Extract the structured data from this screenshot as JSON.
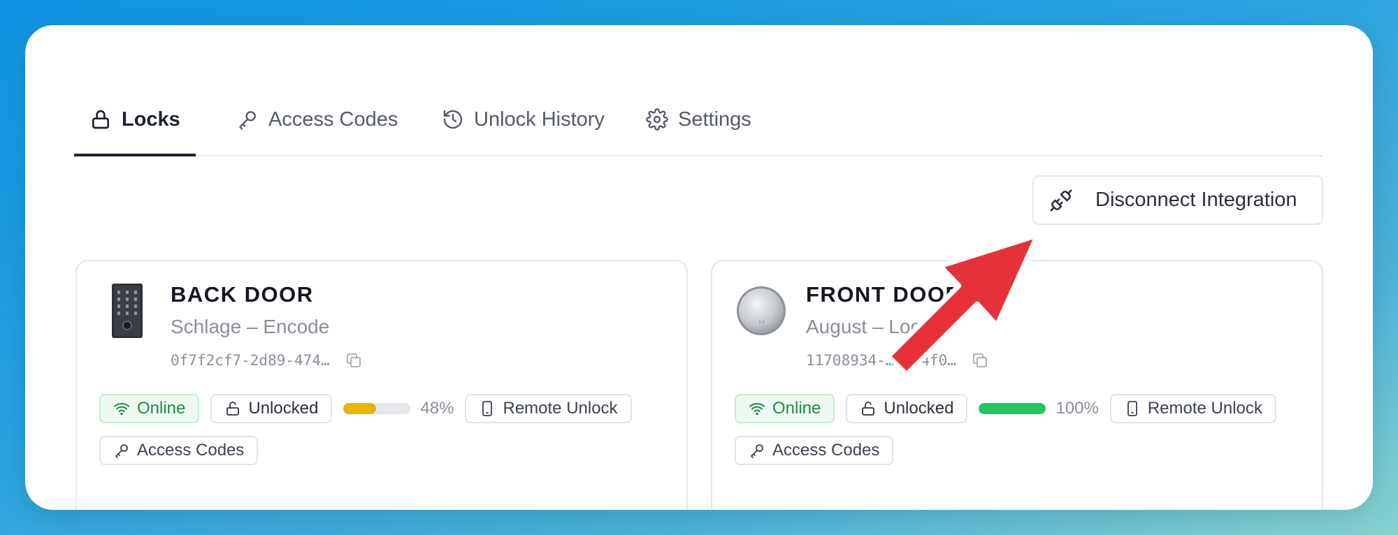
{
  "tabs": [
    {
      "label": "Locks",
      "icon": "lock-icon",
      "active": true
    },
    {
      "label": "Access Codes",
      "icon": "key-icon"
    },
    {
      "label": "Unlock History",
      "icon": "history-icon"
    },
    {
      "label": "Settings",
      "icon": "gear-icon"
    }
  ],
  "disconnect": {
    "label": "Disconnect Integration",
    "icon": "plug-disconnect-icon"
  },
  "locks": [
    {
      "name": "BACK DOOR",
      "model": "Schlage – Encode",
      "id": "0f7f2cf7-2d89-474…",
      "status": "Online",
      "lock_state": "Unlocked",
      "battery_pct": 48,
      "battery_label": "48%",
      "battery_color": "#eab308",
      "remote_label": "Remote Unlock",
      "codes_label": "Access Codes"
    },
    {
      "name": "FRONT DOOR",
      "model": "August – Lock",
      "id": "11708934-…c0-4f0…",
      "status": "Online",
      "lock_state": "Unlocked",
      "battery_pct": 100,
      "battery_label": "100%",
      "battery_color": "#22c55e",
      "remote_label": "Remote Unlock",
      "codes_label": "Access Codes"
    }
  ],
  "colors": {
    "accent": "#1d2230",
    "online": "#1f8a45",
    "arrow": "#e5323a"
  }
}
